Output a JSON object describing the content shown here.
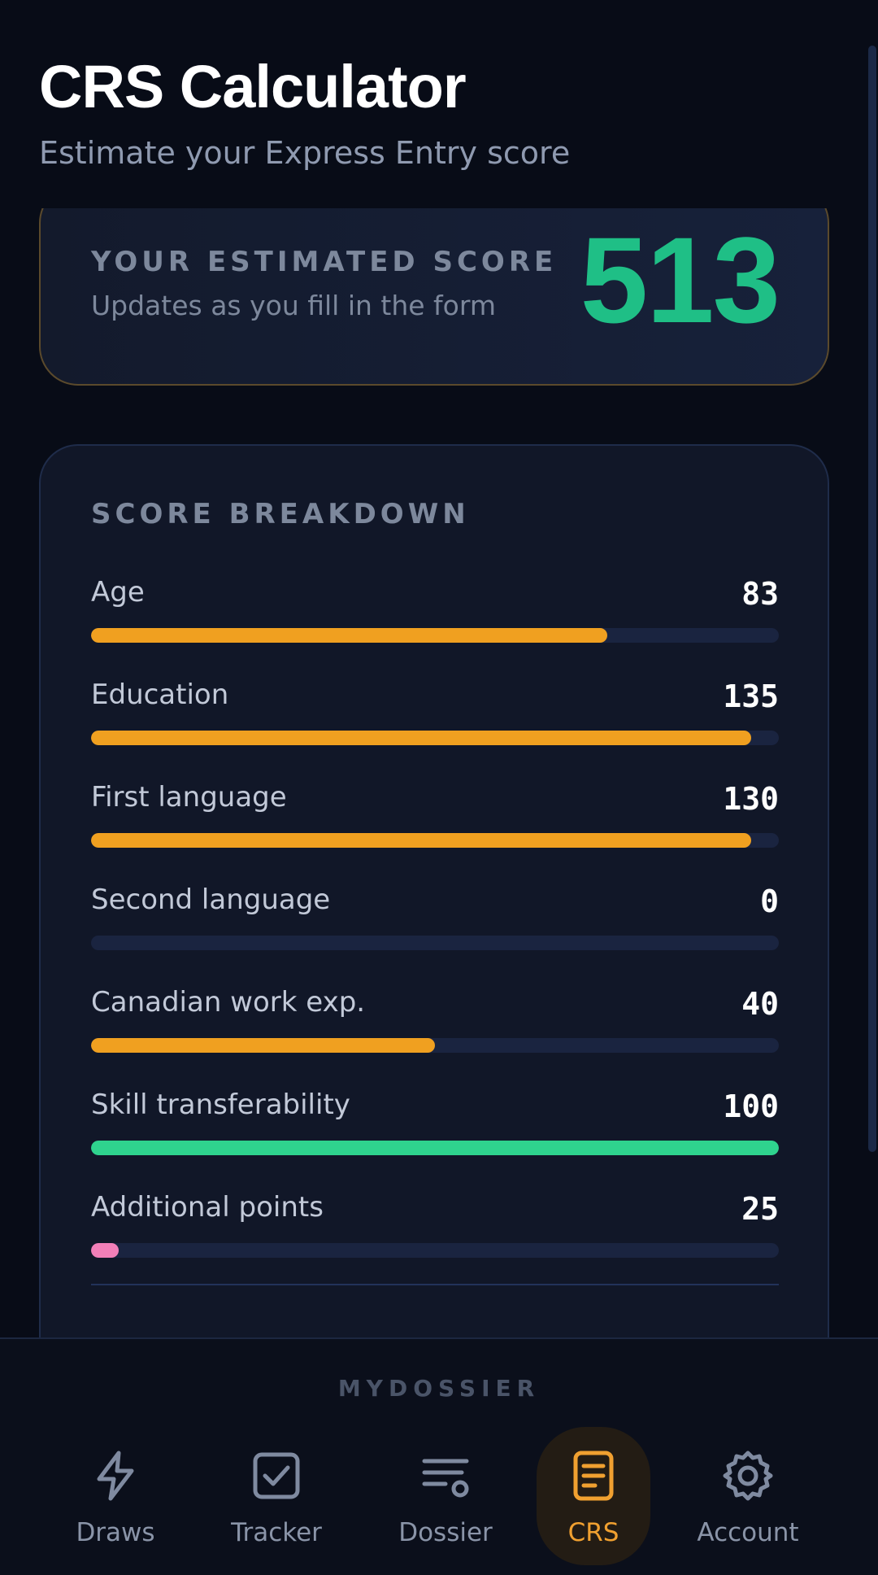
{
  "header": {
    "title": "CRS Calculator",
    "subtitle": "Estimate your Express Entry score"
  },
  "score_card": {
    "label": "YOUR ESTIMATED SCORE",
    "hint": "Updates as you fill in the form",
    "value": "513"
  },
  "breakdown": {
    "title": "SCORE BREAKDOWN",
    "rows": [
      {
        "label": "Age",
        "value": "83",
        "fill": 0.75,
        "color": "#f0a020"
      },
      {
        "label": "Education",
        "value": "135",
        "fill": 0.96,
        "color": "#f0a020"
      },
      {
        "label": "First language",
        "value": "130",
        "fill": 0.96,
        "color": "#f0a020"
      },
      {
        "label": "Second language",
        "value": "0",
        "fill": 0,
        "color": "#f0a020"
      },
      {
        "label": "Canadian work exp.",
        "value": "40",
        "fill": 0.5,
        "color": "#f0a020"
      },
      {
        "label": "Skill transferability",
        "value": "100",
        "fill": 1.0,
        "color": "#2fd38e"
      },
      {
        "label": "Additional points",
        "value": "25",
        "fill": 0.04,
        "color": "#f27fb8"
      }
    ]
  },
  "nav": {
    "brand": "MYDOSSIER",
    "items": [
      {
        "label": "Draws",
        "icon": "lightning-icon",
        "active": false
      },
      {
        "label": "Tracker",
        "icon": "checkbox-icon",
        "active": false
      },
      {
        "label": "Dossier",
        "icon": "list-settings-icon",
        "active": false
      },
      {
        "label": "CRS",
        "icon": "document-icon",
        "active": true
      },
      {
        "label": "Account",
        "icon": "gear-icon",
        "active": false
      }
    ]
  },
  "colors": {
    "accent": "#f0a020",
    "score": "#1fbf86",
    "background": "#0a0f1c"
  }
}
